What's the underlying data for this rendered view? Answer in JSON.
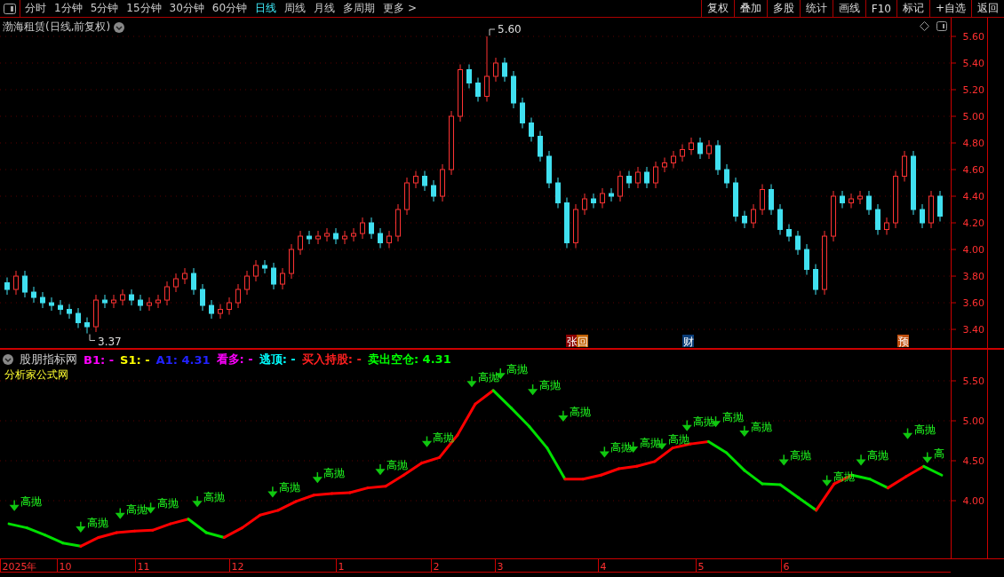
{
  "toolbar": {
    "tabs": [
      {
        "label": "分时",
        "selected": false
      },
      {
        "label": "1分钟",
        "selected": false
      },
      {
        "label": "5分钟",
        "selected": false
      },
      {
        "label": "15分钟",
        "selected": false
      },
      {
        "label": "30分钟",
        "selected": false
      },
      {
        "label": "60分钟",
        "selected": false
      },
      {
        "label": "日线",
        "selected": true
      },
      {
        "label": "周线",
        "selected": false
      },
      {
        "label": "月线",
        "selected": false
      },
      {
        "label": "多周期",
        "selected": false
      },
      {
        "label": "更多 >",
        "selected": false
      }
    ],
    "buttons": [
      "复权",
      "叠加",
      "多股",
      "统计",
      "画线",
      "F10",
      "标记",
      "+自选",
      "返回"
    ]
  },
  "price_panel": {
    "title": "渤海租赁(日线,前复权)",
    "chart_data": {
      "type": "candlestick",
      "ylim": [
        3.247,
        5.74
      ],
      "grid": true,
      "yticks": [
        {
          "value": 3.4,
          "label": "3.40"
        },
        {
          "value": 3.6,
          "label": "3.60"
        },
        {
          "value": 3.8,
          "label": "3.80"
        },
        {
          "value": 4.0,
          "label": "4.00"
        },
        {
          "value": 4.2,
          "label": "4.20"
        },
        {
          "value": 4.4,
          "label": "4.40"
        },
        {
          "value": 4.6,
          "label": "4.60"
        },
        {
          "value": 4.8,
          "label": "4.80"
        },
        {
          "value": 5.0,
          "label": "5.00"
        },
        {
          "value": 5.2,
          "label": "5.20"
        },
        {
          "value": 5.4,
          "label": "5.40"
        },
        {
          "value": 5.6,
          "label": "5.60"
        }
      ],
      "ohlc": [
        [
          3.75,
          3.79,
          3.66,
          3.7
        ],
        [
          3.7,
          3.84,
          3.66,
          3.8
        ],
        [
          3.8,
          3.84,
          3.64,
          3.68
        ],
        [
          3.68,
          3.72,
          3.6,
          3.64
        ],
        [
          3.64,
          3.68,
          3.56,
          3.6
        ],
        [
          3.6,
          3.64,
          3.54,
          3.58
        ],
        [
          3.58,
          3.62,
          3.51,
          3.55
        ],
        [
          3.55,
          3.59,
          3.48,
          3.52
        ],
        [
          3.52,
          3.56,
          3.41,
          3.45
        ],
        [
          3.45,
          3.49,
          3.37,
          3.42
        ],
        [
          3.42,
          3.66,
          3.38,
          3.62
        ],
        [
          3.62,
          3.66,
          3.56,
          3.6
        ],
        [
          3.6,
          3.66,
          3.56,
          3.62
        ],
        [
          3.62,
          3.7,
          3.58,
          3.66
        ],
        [
          3.66,
          3.7,
          3.58,
          3.62
        ],
        [
          3.62,
          3.66,
          3.54,
          3.58
        ],
        [
          3.58,
          3.64,
          3.54,
          3.6
        ],
        [
          3.6,
          3.66,
          3.56,
          3.62
        ],
        [
          3.62,
          3.76,
          3.58,
          3.72
        ],
        [
          3.72,
          3.82,
          3.68,
          3.78
        ],
        [
          3.78,
          3.86,
          3.74,
          3.82
        ],
        [
          3.82,
          3.86,
          3.66,
          3.7
        ],
        [
          3.7,
          3.74,
          3.54,
          3.58
        ],
        [
          3.58,
          3.62,
          3.48,
          3.52
        ],
        [
          3.52,
          3.59,
          3.48,
          3.55
        ],
        [
          3.55,
          3.64,
          3.51,
          3.6
        ],
        [
          3.6,
          3.74,
          3.56,
          3.7
        ],
        [
          3.7,
          3.84,
          3.66,
          3.8
        ],
        [
          3.8,
          3.92,
          3.76,
          3.88
        ],
        [
          3.88,
          3.92,
          3.82,
          3.86
        ],
        [
          3.86,
          3.9,
          3.7,
          3.74
        ],
        [
          3.74,
          3.86,
          3.7,
          3.82
        ],
        [
          3.82,
          4.04,
          3.78,
          4.0
        ],
        [
          4.0,
          4.14,
          3.96,
          4.1
        ],
        [
          4.1,
          4.14,
          4.04,
          4.08
        ],
        [
          4.08,
          4.14,
          4.04,
          4.1
        ],
        [
          4.1,
          4.16,
          4.06,
          4.12
        ],
        [
          4.12,
          4.16,
          4.04,
          4.08
        ],
        [
          4.08,
          4.14,
          4.04,
          4.1
        ],
        [
          4.1,
          4.16,
          4.06,
          4.12
        ],
        [
          4.12,
          4.24,
          4.08,
          4.2
        ],
        [
          4.2,
          4.24,
          4.08,
          4.12
        ],
        [
          4.12,
          4.16,
          4.01,
          4.05
        ],
        [
          4.05,
          4.14,
          4.01,
          4.1
        ],
        [
          4.1,
          4.34,
          4.06,
          4.3
        ],
        [
          4.3,
          4.54,
          4.26,
          4.5
        ],
        [
          4.5,
          4.59,
          4.46,
          4.55
        ],
        [
          4.55,
          4.59,
          4.44,
          4.48
        ],
        [
          4.48,
          4.52,
          4.36,
          4.4
        ],
        [
          4.4,
          4.64,
          4.36,
          4.6
        ],
        [
          4.6,
          5.04,
          4.56,
          5.0
        ],
        [
          5.0,
          5.39,
          4.96,
          5.35
        ],
        [
          5.35,
          5.39,
          5.21,
          5.25
        ],
        [
          5.25,
          5.29,
          5.11,
          5.15
        ],
        [
          5.15,
          5.6,
          5.11,
          5.3
        ],
        [
          5.3,
          5.44,
          5.26,
          5.4
        ],
        [
          5.4,
          5.44,
          5.26,
          5.3
        ],
        [
          5.3,
          5.34,
          5.06,
          5.1
        ],
        [
          5.1,
          5.14,
          4.91,
          4.95
        ],
        [
          4.95,
          4.99,
          4.81,
          4.85
        ],
        [
          4.85,
          4.89,
          4.66,
          4.7
        ],
        [
          4.7,
          4.74,
          4.46,
          4.5
        ],
        [
          4.5,
          4.54,
          4.31,
          4.35
        ],
        [
          4.35,
          4.39,
          4.01,
          4.05
        ],
        [
          4.05,
          4.34,
          4.01,
          4.3
        ],
        [
          4.3,
          4.42,
          4.26,
          4.38
        ],
        [
          4.38,
          4.42,
          4.31,
          4.35
        ],
        [
          4.35,
          4.46,
          4.31,
          4.42
        ],
        [
          4.42,
          4.46,
          4.36,
          4.4
        ],
        [
          4.4,
          4.59,
          4.36,
          4.55
        ],
        [
          4.55,
          4.59,
          4.46,
          4.5
        ],
        [
          4.5,
          4.62,
          4.46,
          4.58
        ],
        [
          4.58,
          4.62,
          4.46,
          4.5
        ],
        [
          4.5,
          4.66,
          4.46,
          4.62
        ],
        [
          4.62,
          4.69,
          4.58,
          4.65
        ],
        [
          4.65,
          4.74,
          4.61,
          4.7
        ],
        [
          4.7,
          4.79,
          4.66,
          4.75
        ],
        [
          4.75,
          4.84,
          4.71,
          4.8
        ],
        [
          4.8,
          4.84,
          4.68,
          4.72
        ],
        [
          4.72,
          4.82,
          4.68,
          4.78
        ],
        [
          4.78,
          4.82,
          4.56,
          4.6
        ],
        [
          4.6,
          4.64,
          4.46,
          4.5
        ],
        [
          4.5,
          4.54,
          4.21,
          4.25
        ],
        [
          4.25,
          4.29,
          4.16,
          4.2
        ],
        [
          4.2,
          4.34,
          4.16,
          4.3
        ],
        [
          4.3,
          4.49,
          4.26,
          4.45
        ],
        [
          4.45,
          4.49,
          4.26,
          4.3
        ],
        [
          4.3,
          4.34,
          4.11,
          4.15
        ],
        [
          4.15,
          4.19,
          4.06,
          4.1
        ],
        [
          4.1,
          4.14,
          3.96,
          4.0
        ],
        [
          4.0,
          4.04,
          3.81,
          3.85
        ],
        [
          3.85,
          3.89,
          3.66,
          3.7
        ],
        [
          3.7,
          4.14,
          3.66,
          4.1
        ],
        [
          4.1,
          4.44,
          4.06,
          4.4
        ],
        [
          4.4,
          4.44,
          4.31,
          4.35
        ],
        [
          4.35,
          4.42,
          4.31,
          4.38
        ],
        [
          4.38,
          4.44,
          4.34,
          4.4
        ],
        [
          4.4,
          4.44,
          4.26,
          4.3
        ],
        [
          4.3,
          4.34,
          4.11,
          4.15
        ],
        [
          4.15,
          4.24,
          4.11,
          4.2
        ],
        [
          4.2,
          4.59,
          4.16,
          4.55
        ],
        [
          4.55,
          4.74,
          4.51,
          4.7
        ],
        [
          4.7,
          4.74,
          4.26,
          4.3
        ],
        [
          4.3,
          4.34,
          4.16,
          4.2
        ],
        [
          4.2,
          4.44,
          4.16,
          4.4
        ],
        [
          4.4,
          4.44,
          4.21,
          4.25
        ]
      ],
      "annotations": [
        "5.60",
        "3.37"
      ]
    },
    "events": [
      {
        "text": "张",
        "color": "#8b0000"
      },
      {
        "text": "回",
        "color": "#c06000"
      },
      {
        "text": "财",
        "color": "#0a3d78"
      },
      {
        "text": "预",
        "color": "#c05010"
      }
    ]
  },
  "indicator_panel": {
    "name": "股朋指标网",
    "subtitle": "分析家公式网",
    "legend": [
      {
        "label": "B1:",
        "value": "-",
        "color": "#ff00ff"
      },
      {
        "label": "S1:",
        "value": "-",
        "color": "#ffff00"
      },
      {
        "label": "A1:",
        "value": "4.31",
        "color": "#2222ff"
      },
      {
        "label": "看多:",
        "value": "-",
        "color": "#ff00ff"
      },
      {
        "label": "逃顶:",
        "value": "-",
        "color": "#00ffff"
      },
      {
        "label": "买入持股:",
        "value": "-",
        "color": "#ff2020"
      },
      {
        "label": "卖出空仓:",
        "value": "4.31",
        "color": "#00ff00"
      }
    ],
    "chart_data": {
      "type": "line",
      "ylim": [
        3.267,
        5.889
      ],
      "grid": true,
      "yticks": [
        {
          "value": 4.0,
          "label": "4.00"
        },
        {
          "value": 4.5,
          "label": "4.50"
        },
        {
          "value": 5.0,
          "label": "5.00"
        },
        {
          "value": 5.5,
          "label": "5.50"
        }
      ],
      "series": [
        {
          "color": "#ff0000",
          "values": [
            null,
            null,
            null,
            null,
            3.43,
            3.54,
            3.6,
            3.62,
            3.63,
            3.71,
            3.77,
            null,
            3.54,
            3.66,
            3.82,
            3.88,
            3.99,
            4.07,
            4.09,
            4.1,
            4.16,
            4.18,
            4.32,
            4.47,
            4.54,
            4.82,
            5.21,
            5.38,
            null,
            null,
            null,
            4.27,
            4.27,
            4.32,
            4.4,
            4.43,
            4.49,
            4.66,
            4.71,
            4.74,
            null,
            null,
            null,
            null,
            null,
            3.88,
            4.21,
            4.32,
            null,
            4.16,
            4.3,
            4.43,
            null
          ]
        },
        {
          "color": "#00e000",
          "values": [
            3.71,
            3.66,
            3.57,
            3.47,
            3.43,
            null,
            null,
            null,
            null,
            null,
            3.77,
            3.6,
            3.54,
            null,
            null,
            null,
            null,
            null,
            null,
            null,
            null,
            null,
            null,
            null,
            null,
            null,
            null,
            5.38,
            5.16,
            4.93,
            4.66,
            4.27,
            null,
            null,
            null,
            null,
            null,
            null,
            null,
            4.74,
            4.6,
            4.38,
            4.21,
            4.2,
            4.04,
            3.88,
            null,
            4.32,
            4.27,
            4.16,
            null,
            4.43,
            4.32
          ]
        }
      ],
      "annotations": [
        "高抛",
        "高抛",
        "高抛",
        "高抛",
        "高抛",
        "高抛",
        "高抛",
        "高抛",
        "高抛",
        "高抛",
        "高抛",
        "高抛",
        "高抛",
        "高抛",
        "高抛",
        "高抛",
        "高抛",
        "高抛",
        "高抛",
        "高抛",
        "高抛",
        "高抛",
        "高抛",
        "高"
      ]
    },
    "date_axis": [
      "2025年",
      "10",
      "11",
      "12",
      "1",
      "2",
      "3",
      "4",
      "5",
      "6"
    ]
  }
}
